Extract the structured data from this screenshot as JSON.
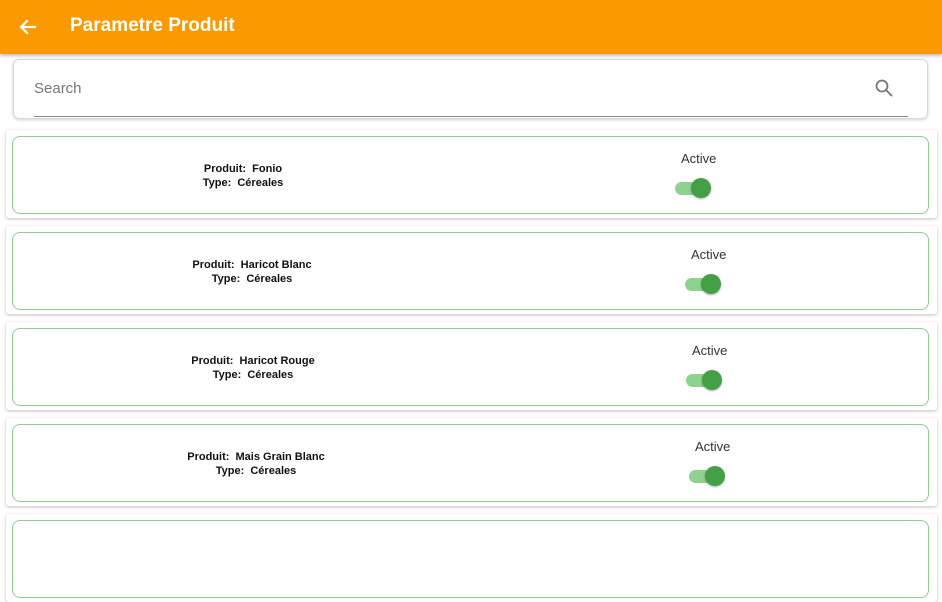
{
  "app_bar": {
    "title": "Parametre Produit",
    "back_icon": "arrow-left-icon",
    "background_color": "#fb9a00"
  },
  "search": {
    "placeholder": "Search",
    "value": "",
    "icon": "search-icon"
  },
  "products": [
    {
      "product_label": "Produit:  Fonio",
      "type_label": "Type:  Céreales",
      "status_label": "Active",
      "active": true
    },
    {
      "product_label": "Produit:  Haricot Blanc",
      "type_label": "Type:  Céreales",
      "status_label": "Active",
      "active": true
    },
    {
      "product_label": "Produit:  Haricot Rouge",
      "type_label": "Type:  Céreales",
      "status_label": "Active",
      "active": true
    },
    {
      "product_label": "Produit:  Mais Grain Blanc",
      "type_label": "Type:  Céreales",
      "status_label": "Active",
      "active": true
    }
  ],
  "colors": {
    "accent": "#fb9a00",
    "toggle_on": "#43a047",
    "card_border": "#8cd08c"
  }
}
